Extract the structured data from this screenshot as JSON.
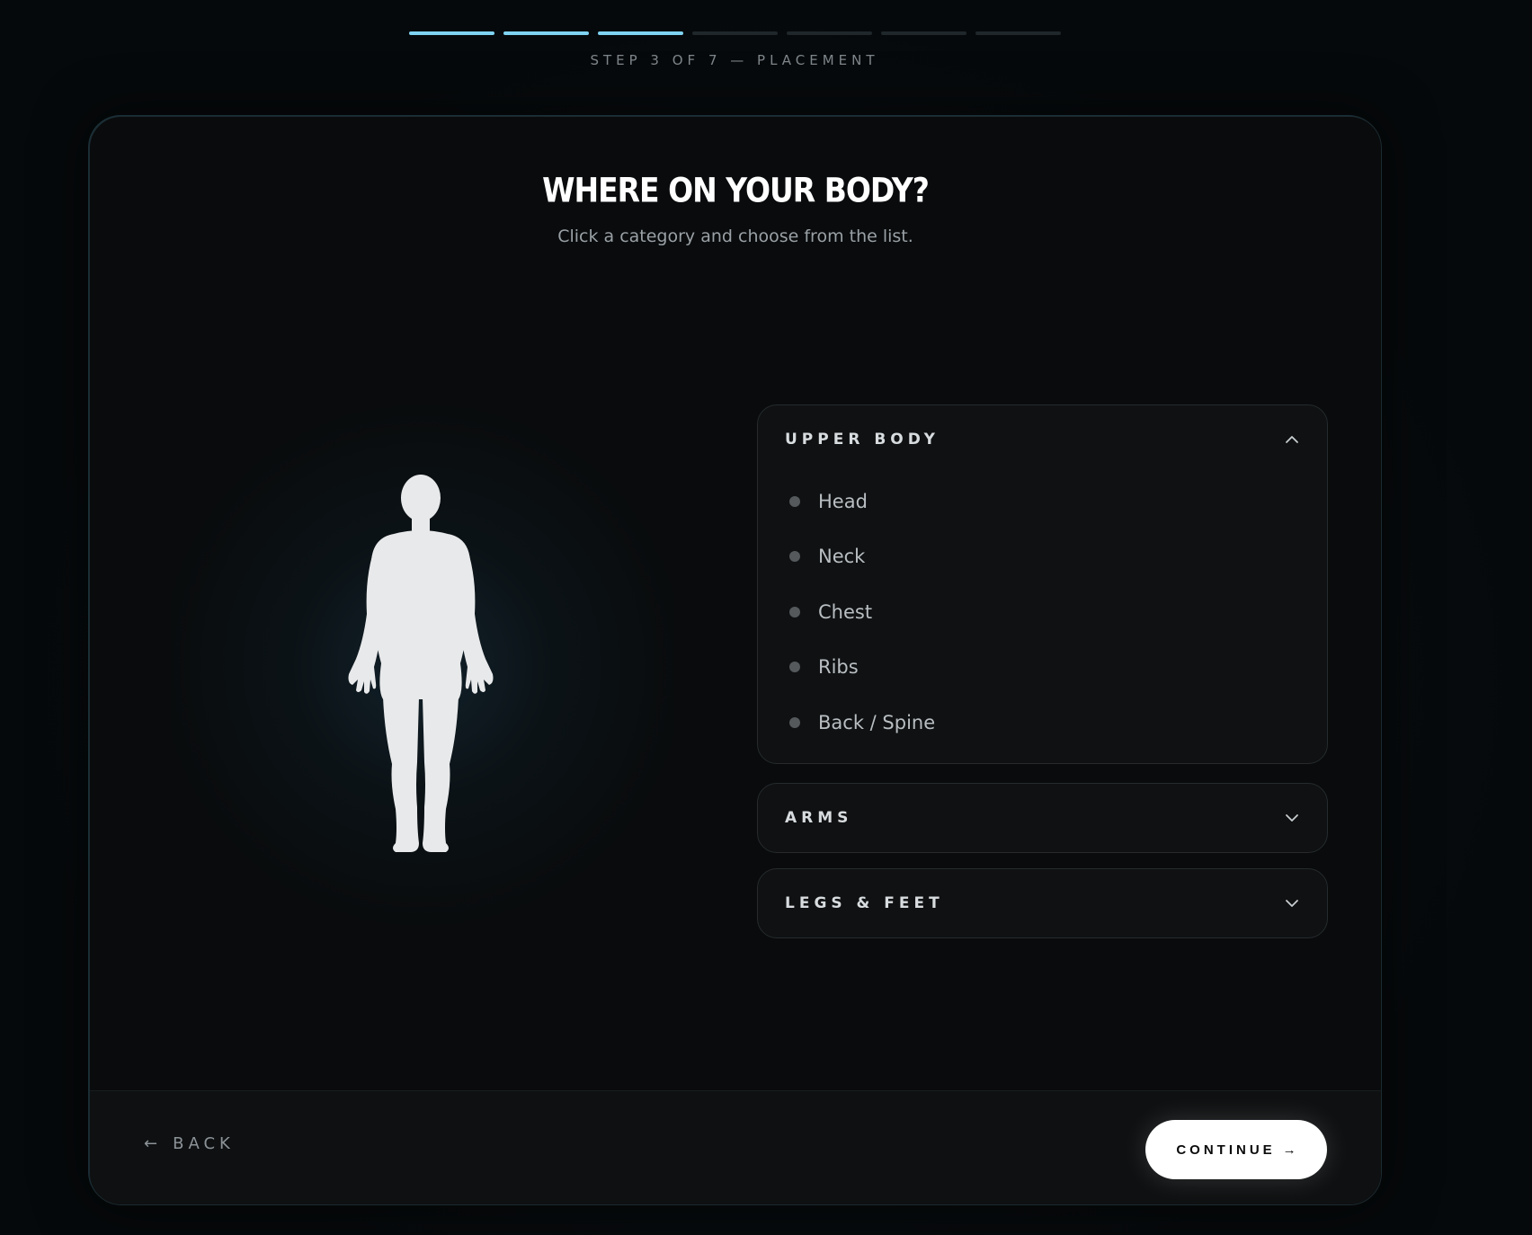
{
  "progress": {
    "step_label": "STEP 3 OF 7 — PLACEMENT",
    "total_steps": 7,
    "completed_steps": 3
  },
  "header": {
    "title": "WHERE ON YOUR BODY?",
    "subtitle": "Click a category and choose from the list."
  },
  "accordion": {
    "upper_body": {
      "title": "UPPER BODY",
      "expanded": true,
      "items": [
        "Head",
        "Neck",
        "Chest",
        "Ribs",
        "Back / Spine"
      ]
    },
    "arms": {
      "title": "ARMS",
      "expanded": false
    },
    "legs": {
      "title": "LEGS & FEET",
      "expanded": false
    }
  },
  "footer": {
    "back_label": "BACK",
    "continue_label": "CONTINUE"
  },
  "icons": {
    "back": "arrow-left-icon",
    "continue": "arrow-right-icon",
    "collapse": "chevron-up-icon",
    "expand": "chevron-down-icon"
  },
  "colors": {
    "accent": "#7fd3f2",
    "background": "#06090b",
    "card": "#090b0c"
  }
}
